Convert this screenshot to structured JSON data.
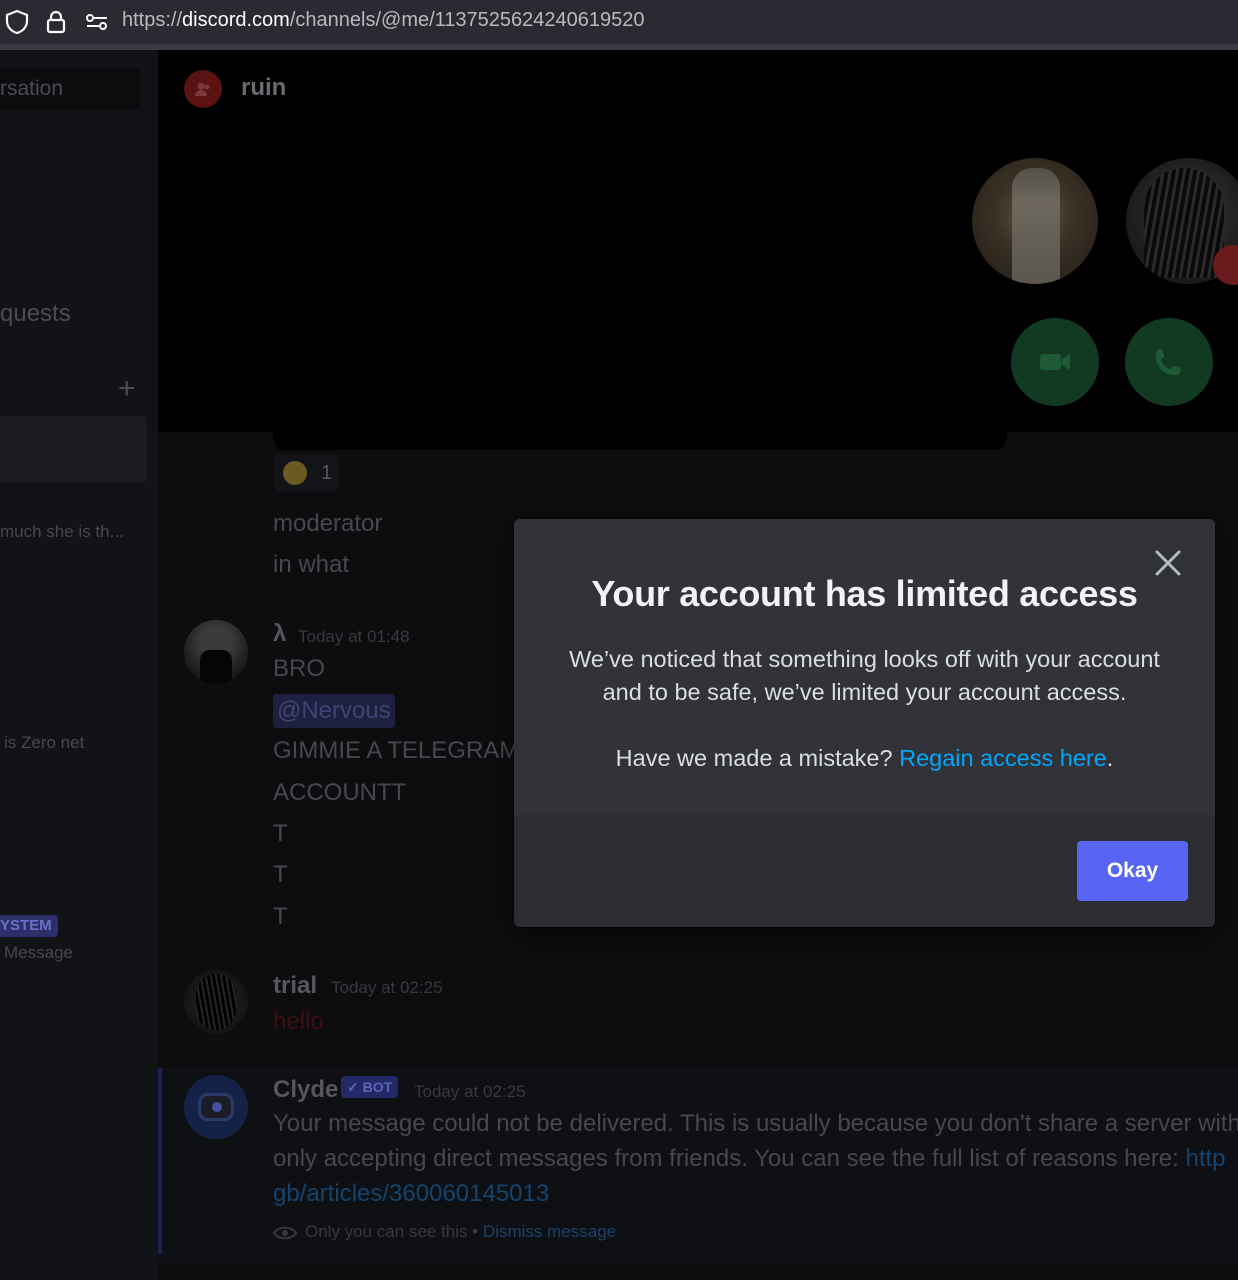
{
  "browser": {
    "url_scheme": "https://",
    "url_host": "discord.com",
    "url_path": "/channels/@me/1137525624240619520"
  },
  "sidebar": {
    "search_partial": "rsation",
    "requests_partial": "quests",
    "dm_preview_1": "much she is th...",
    "dm_preview_2": "is Zero net",
    "system_badge": "YSTEM",
    "system_preview": "Message"
  },
  "header": {
    "title": "ruin"
  },
  "chat": {
    "reaction_count": "1",
    "lines_top": [
      "moderator",
      "in what"
    ],
    "msg1": {
      "author": "λ",
      "timestamp": "Today at 01:48",
      "lines": [
        "BRO",
        "GIMMIE A TELEGRAM",
        "ACCOUNTT",
        "T",
        "T",
        "T"
      ],
      "mention": "@Nervous"
    },
    "msg2": {
      "author": "trial",
      "timestamp": "Today at 02:25",
      "text": "hello"
    },
    "msg3": {
      "author": "Clyde",
      "bot_tag": "✓ BOT",
      "timestamp": "Today at 02:25",
      "line1": "Your message could not be delivered. This is usually because you don't share a server with",
      "line2_text": "only accepting direct messages from friends. You can see the full list of reasons here: ",
      "line2_link": "http",
      "line3_link": "gb/articles/360060145013",
      "ephemeral_note": "Only you can see this • ",
      "dismiss": "Dismiss message"
    }
  },
  "modal": {
    "title": "Your account has limited access",
    "description_line1": "We’ve noticed that something looks off with your account",
    "description_line2": "and to be safe, we’ve limited your account access.",
    "question": "Have we made a mistake? ",
    "link": "Regain access here",
    "link_suffix": ".",
    "ok_label": "Okay"
  },
  "colors": {
    "modal_bg": "#313338",
    "footer_bg": "#2b2d31",
    "accent": "#5865f2",
    "link": "#00a8fc"
  }
}
